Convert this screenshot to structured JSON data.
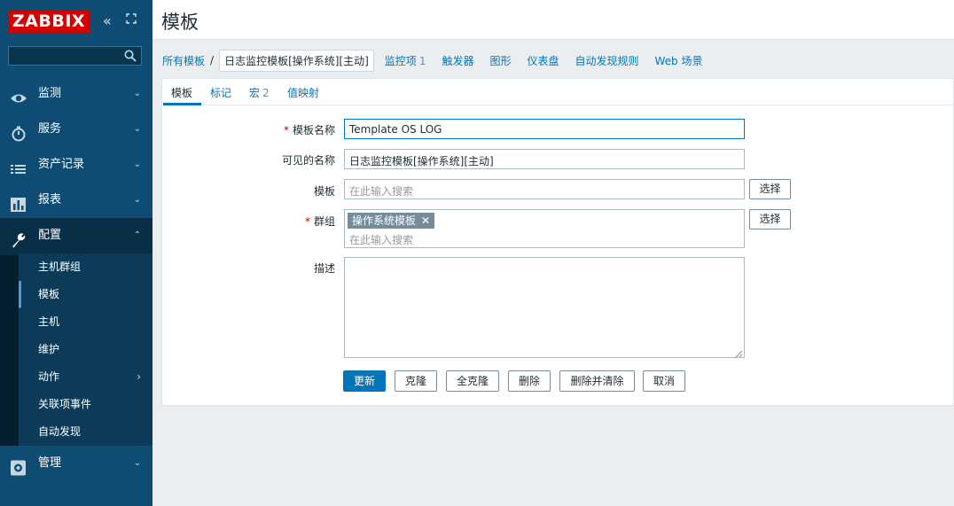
{
  "brand": {
    "logo_text": "ZABBIX",
    "logo_color": "#d40000"
  },
  "sidebar": {
    "search": {
      "value": "",
      "placeholder": ""
    },
    "items": [
      {
        "label": "监测",
        "icon": "eye-icon"
      },
      {
        "label": "服务",
        "icon": "stopwatch-icon"
      },
      {
        "label": "资产记录",
        "icon": "list-icon"
      },
      {
        "label": "报表",
        "icon": "bar-chart-icon"
      },
      {
        "label": "配置",
        "icon": "wrench-icon"
      },
      {
        "label": "管理",
        "icon": "gear-icon"
      }
    ],
    "submenu": [
      {
        "label": "主机群组"
      },
      {
        "label": "模板"
      },
      {
        "label": "主机"
      },
      {
        "label": "维护"
      },
      {
        "label": "动作"
      },
      {
        "label": "关联项事件"
      },
      {
        "label": "自动发现"
      }
    ]
  },
  "header": {
    "title": "模板"
  },
  "nav": {
    "all_templates": "所有模板",
    "separator": "/",
    "current": "日志监控模板[操作系统][主动]",
    "items": {
      "label": "监控项",
      "count": "1"
    },
    "triggers": "触发器",
    "graphs": "图形",
    "dashboards": "仪表盘",
    "discovery": "自动发现规则",
    "web": "Web 场景"
  },
  "tabs": {
    "template": "模板",
    "tags": "标记",
    "macros": {
      "label": "宏",
      "count": "2"
    },
    "value_mapping": "值映射"
  },
  "form": {
    "template_name": {
      "label": "模板名称",
      "value": "Template OS LOG"
    },
    "visible_name": {
      "label": "可见的名称",
      "value": "日志监控模板[操作系统][主动]"
    },
    "templates": {
      "label": "模板",
      "placeholder": "在此输入搜索"
    },
    "groups": {
      "label": "群组",
      "tag": "操作系统模板",
      "placeholder": "在此输入搜索"
    },
    "description": {
      "label": "描述",
      "value": ""
    },
    "select_label": "选择",
    "required_mark": "*"
  },
  "buttons": {
    "update": "更新",
    "clone": "克隆",
    "full_clone": "全克隆",
    "delete": "删除",
    "delete_clear": "删除并清除",
    "cancel": "取消"
  }
}
